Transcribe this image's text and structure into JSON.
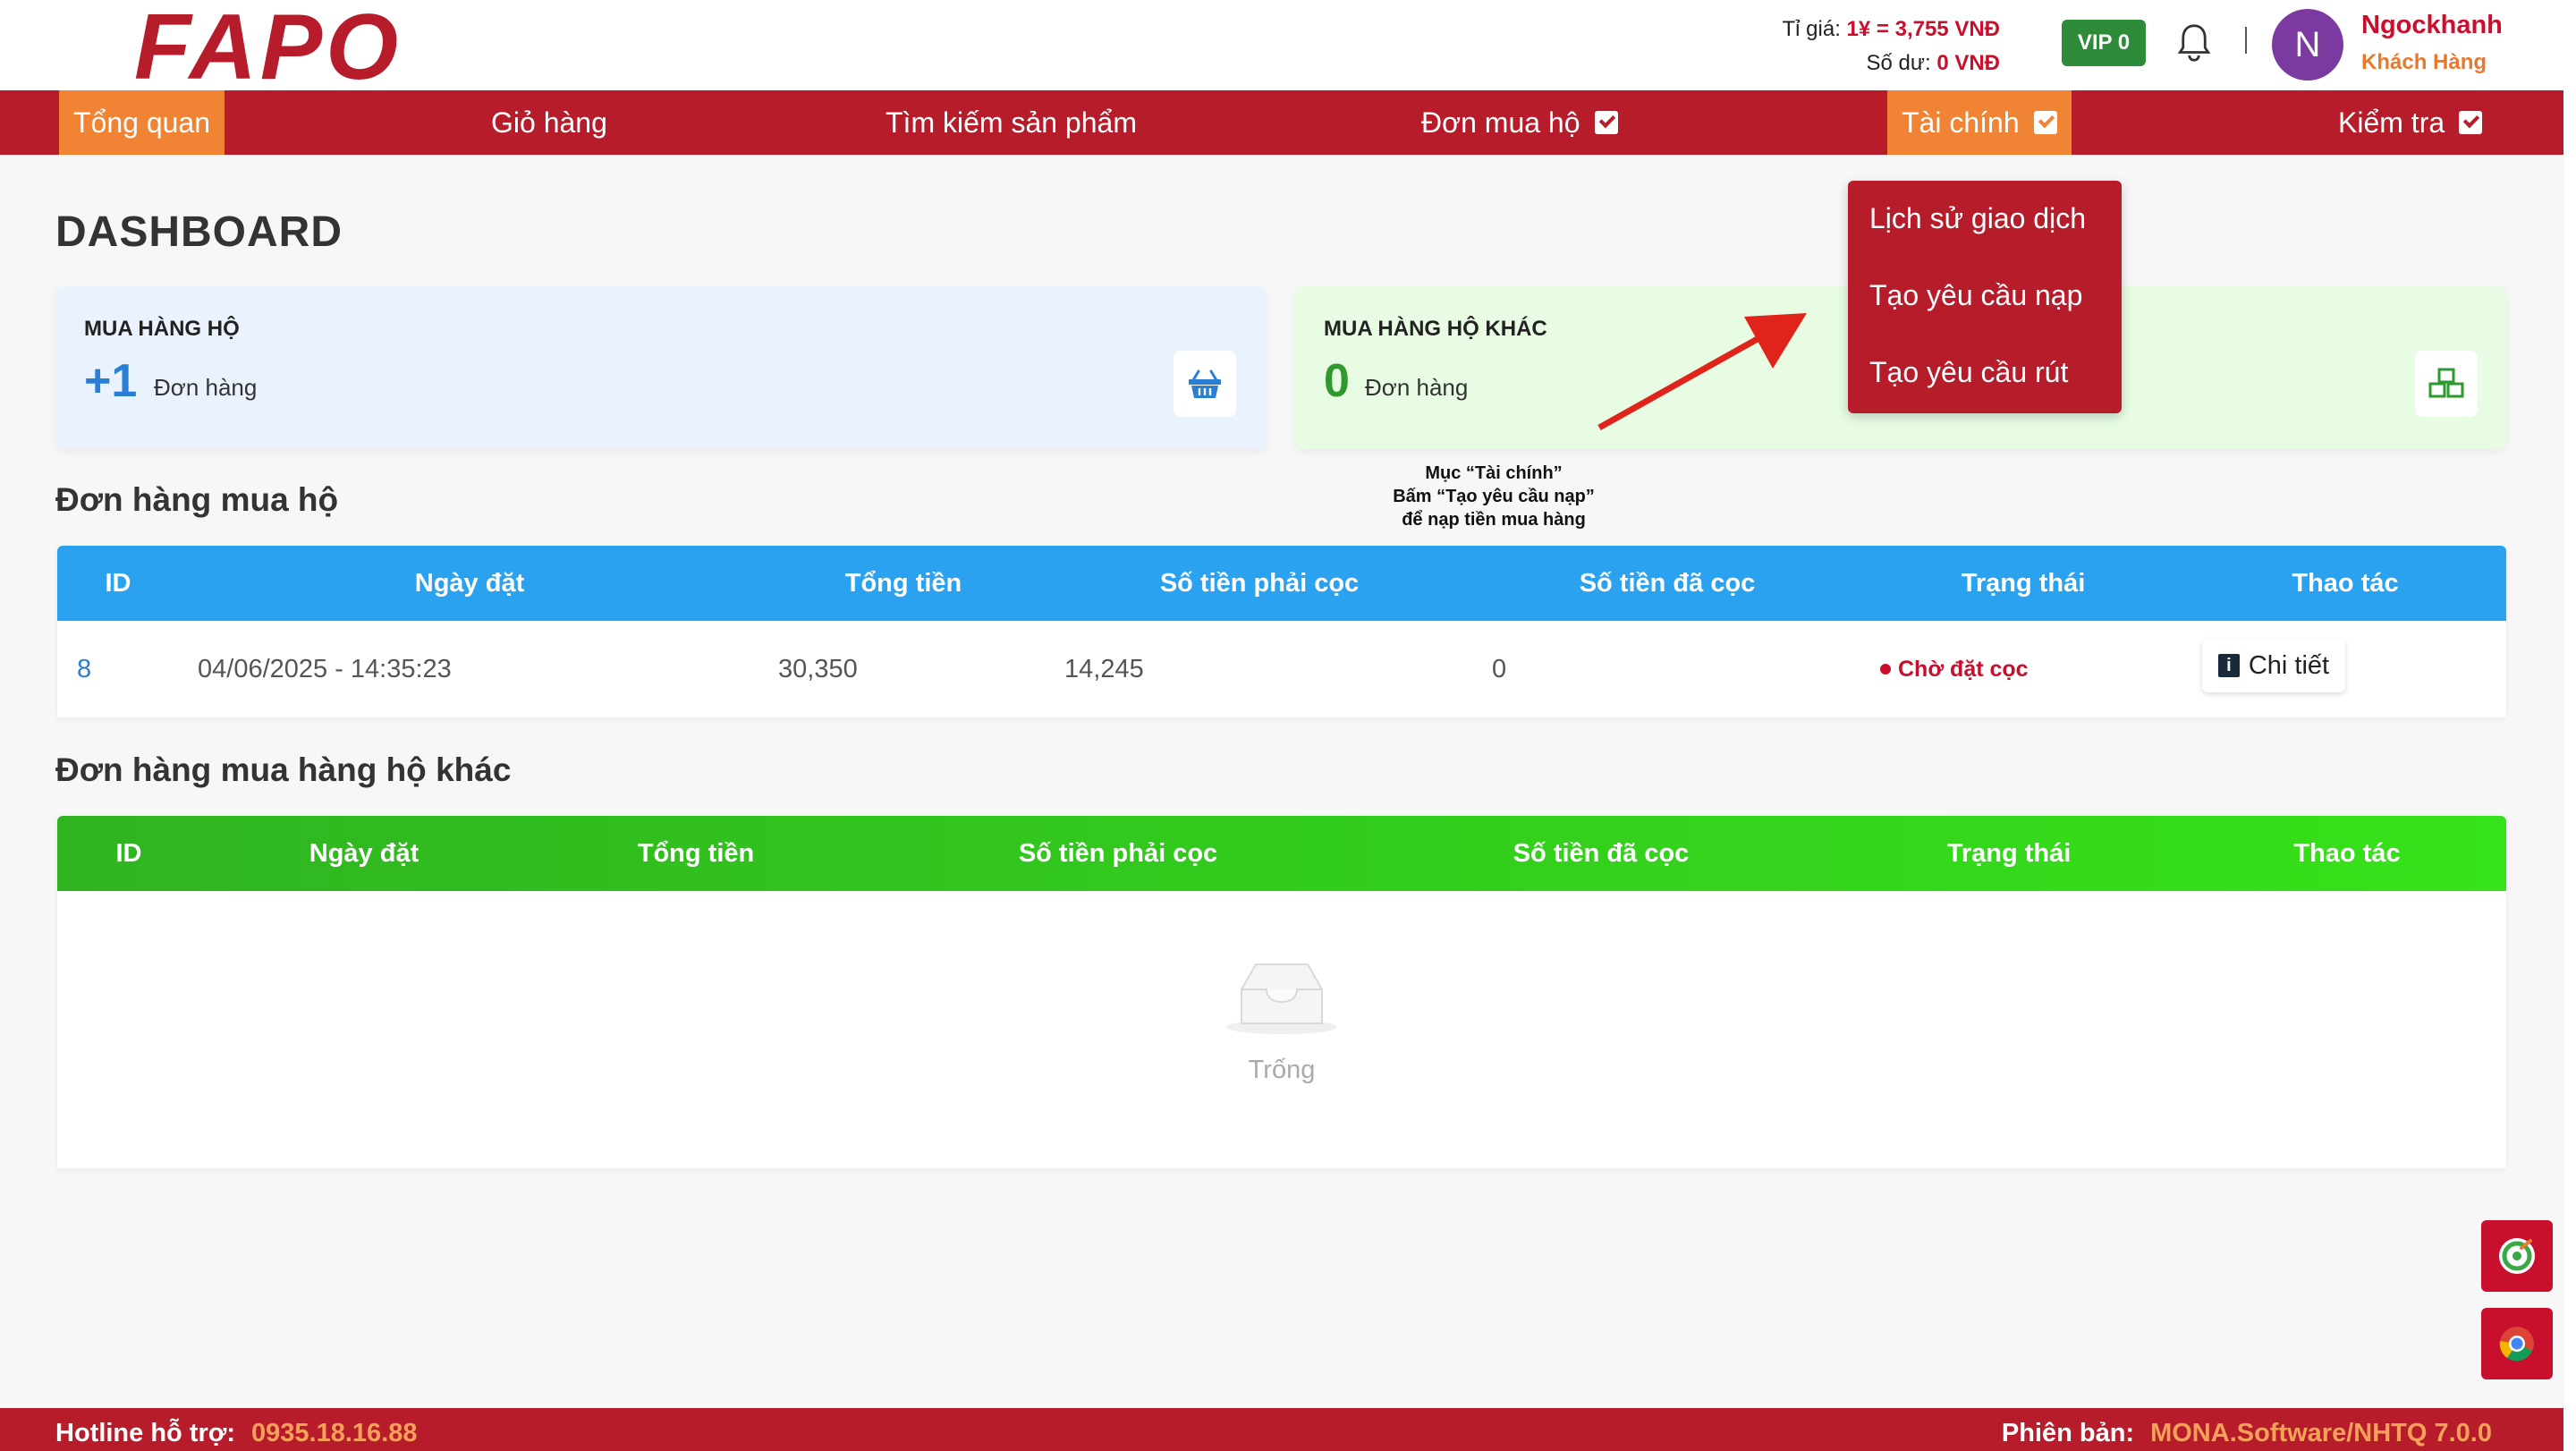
{
  "header": {
    "logo_text": "FAPO",
    "rate_label": "Tỉ giá:",
    "rate_value": "1¥ = 3,755 VNĐ",
    "balance_label": "Số dư:",
    "balance_value": "0 VNĐ",
    "vip": "VIP 0",
    "avatar_initial": "N",
    "user_name": "Ngockhanh",
    "user_role": "Khách Hàng"
  },
  "nav": {
    "items": [
      {
        "label": "Tổng quan"
      },
      {
        "label": "Giỏ hàng"
      },
      {
        "label": "Tìm kiếm sản phẩm"
      },
      {
        "label": "Đơn mua hộ"
      },
      {
        "label": "Tài chính"
      },
      {
        "label": "Kiểm tra"
      }
    ]
  },
  "dropdown": {
    "items": [
      "Lịch sử giao dịch",
      "Tạo yêu cầu nạp",
      "Tạo yêu cầu rút"
    ]
  },
  "page_title": "DASHBOARD",
  "cards": [
    {
      "label": "MUA HÀNG HỘ",
      "value": "+1",
      "unit": "Đơn hàng",
      "icon": "basket-icon",
      "color": "#2a7fd4"
    },
    {
      "label": "MUA HÀNG HỘ KHÁC",
      "value": "0",
      "unit": "Đơn hàng",
      "icon": "boxes-icon",
      "color": "#2e9a2e"
    }
  ],
  "annotation": {
    "line1": "Mục “Tài chính”",
    "line2": "Bấm “Tạo yêu cầu nạp”",
    "line3": "để nạp tiền mua hàng"
  },
  "section1": {
    "title": "Đơn hàng mua hộ",
    "headers": [
      "ID",
      "Ngày đặt",
      "Tổng tiền",
      "Số tiền phải cọc",
      "Số tiền đã cọc",
      "Trạng thái",
      "Thao tác"
    ],
    "row": {
      "id": "8",
      "date": "04/06/2025 - 14:35:23",
      "total": "30,350",
      "deposit_required": "14,245",
      "deposit_paid": "0",
      "status": "Chờ đặt cọc",
      "action": "Chi tiết"
    }
  },
  "section2": {
    "title": "Đơn hàng mua hàng hộ khác",
    "headers": [
      "ID",
      "Ngày đặt",
      "Tổng tiền",
      "Số tiền phải cọc",
      "Số tiền đã cọc",
      "Trạng thái",
      "Thao tác"
    ],
    "empty_text": "Trống"
  },
  "footer": {
    "hotline_label": "Hotline hỗ trợ:",
    "hotline_value": "0935.18.16.88",
    "version_label": "Phiên bản:",
    "version_value": "MONA.Software/NHTQ 7.0.0"
  },
  "colors": {
    "brand": "#b71c2b",
    "accent": "#f08434",
    "blue": "#2aa2f0",
    "green": "#36e21a"
  }
}
